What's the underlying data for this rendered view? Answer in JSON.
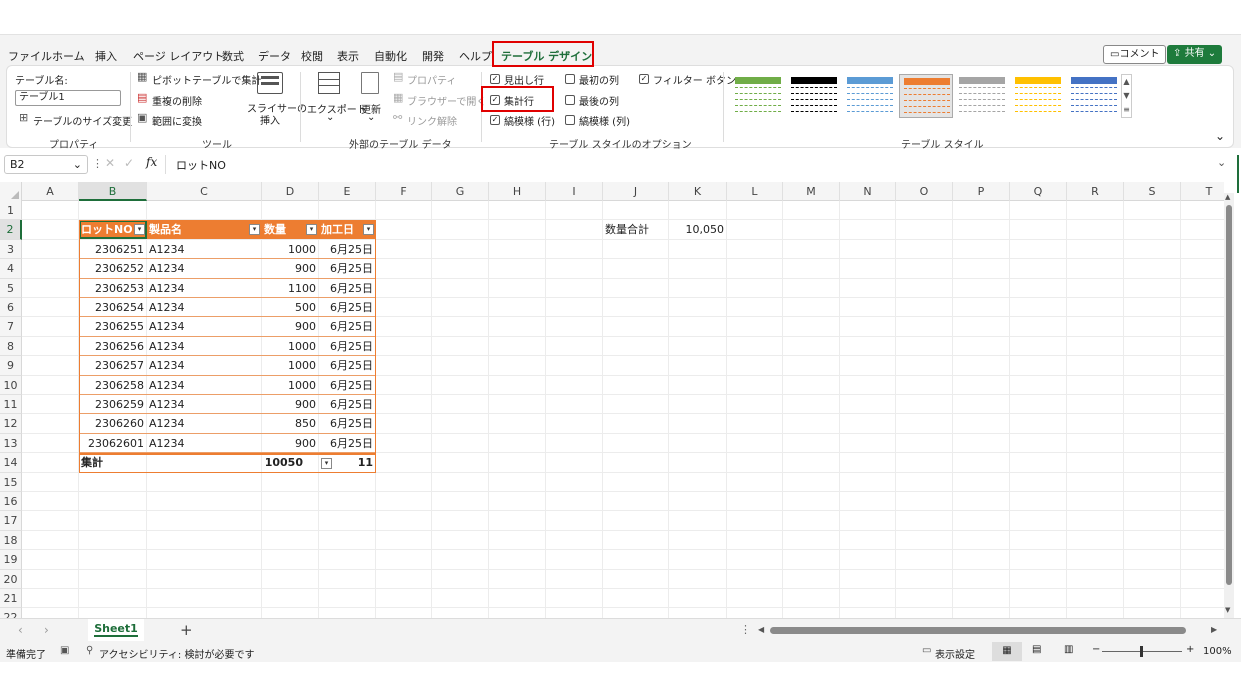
{
  "tabs": [
    "ファイル",
    "ホーム",
    "挿入",
    "ページ レイアウト",
    "数式",
    "データ",
    "校閲",
    "表示",
    "自動化",
    "開発",
    "ヘルプ",
    "テーブル デザイン"
  ],
  "active_tab": "テーブル デザイン",
  "top_buttons": {
    "comment": "コメント",
    "share": "共有"
  },
  "ribbon": {
    "properties": {
      "name_label": "テーブル名:",
      "table_name": "テーブル1",
      "resize": "テーブルのサイズ変更",
      "group": "プロパティ"
    },
    "tools": {
      "pivot": "ピボットテーブルで集計",
      "remove_dup": "重複の削除",
      "convert": "範囲に変換",
      "slicer_1": "スライサーの",
      "slicer_2": "挿入",
      "group": "ツール"
    },
    "external": {
      "export": "エクスポート",
      "refresh": "更新",
      "properties": "プロパティ",
      "browser": "ブラウザーで開く",
      "unlink": "リンク解除",
      "group": "外部のテーブル データ"
    },
    "style_options": {
      "header_row": "見出し行",
      "total_row": "集計行",
      "banded_rows": "縞模様 (行)",
      "first_col": "最初の列",
      "last_col": "最後の列",
      "banded_cols": "縞模様 (列)",
      "filter_btn": "フィルター ボタン",
      "group": "テーブル スタイルのオプション"
    },
    "styles_group": "テーブル スタイル",
    "style_colors": [
      "#70ad47",
      "#000000",
      "#5b9bd5",
      "#ed7d31",
      "#a5a5a5",
      "#ffc000",
      "#4472c4"
    ]
  },
  "formula_bar": {
    "name_box": "B2",
    "fx": "fx",
    "content": "ロットNO"
  },
  "columns": [
    "A",
    "B",
    "C",
    "D",
    "E",
    "F",
    "G",
    "H",
    "I",
    "J",
    "K",
    "L",
    "M",
    "N",
    "O",
    "P",
    "Q",
    "R",
    "S",
    "T"
  ],
  "rows": [
    "1",
    "2",
    "3",
    "4",
    "5",
    "6",
    "7",
    "8",
    "9",
    "10",
    "11",
    "12",
    "13",
    "14",
    "15",
    "16",
    "17",
    "18",
    "19",
    "20",
    "21",
    "22"
  ],
  "table": {
    "headers": [
      "ロットNO",
      "製品名",
      "数量",
      "加工日"
    ],
    "rows": [
      [
        "2306251",
        "A1234",
        "1000",
        "6月25日"
      ],
      [
        "2306252",
        "A1234",
        "900",
        "6月25日"
      ],
      [
        "2306253",
        "A1234",
        "1100",
        "6月25日"
      ],
      [
        "2306254",
        "A1234",
        "500",
        "6月25日"
      ],
      [
        "2306255",
        "A1234",
        "900",
        "6月25日"
      ],
      [
        "2306256",
        "A1234",
        "1000",
        "6月25日"
      ],
      [
        "2306257",
        "A1234",
        "1000",
        "6月25日"
      ],
      [
        "2306258",
        "A1234",
        "1000",
        "6月25日"
      ],
      [
        "2306259",
        "A1234",
        "900",
        "6月25日"
      ],
      [
        "2306260",
        "A1234",
        "850",
        "6月25日"
      ],
      [
        "23062601",
        "A1234",
        "900",
        "6月25日"
      ]
    ],
    "total": {
      "label": "集計",
      "qty": "10050",
      "date": "11"
    },
    "header_color": "#ed7d31"
  },
  "summary": {
    "label": "数量合計",
    "value": "10,050"
  },
  "sheet_tab": "Sheet1",
  "status": {
    "ready": "準備完了",
    "accessibility": "アクセシビリティ: 検討が必要です",
    "display_settings": "表示設定",
    "zoom": "100%"
  }
}
